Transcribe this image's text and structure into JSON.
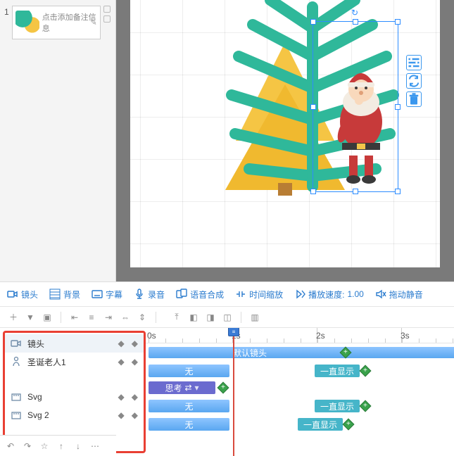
{
  "slide": {
    "number": "1",
    "caption": "点击添加备注信息"
  },
  "object_toolbar": {
    "settings": "settings",
    "replace": "replace",
    "delete": "delete"
  },
  "main_toolbar": {
    "camera": "镜头",
    "background": "背景",
    "subtitle": "字幕",
    "record": "录音",
    "tts": "语音合成",
    "timescale": "时间缩放",
    "speed_label": "播放速度:",
    "speed_value": "1.00",
    "drag_mute": "拖动静音"
  },
  "tracks": [
    {
      "icon": "camera",
      "name": "镜头"
    },
    {
      "icon": "person",
      "name": "圣诞老人1"
    },
    {
      "icon": "svg",
      "name": "Svg"
    },
    {
      "icon": "svg",
      "name": "Svg 2"
    }
  ],
  "ruler": {
    "ticks": [
      "0s",
      "1s",
      "2s",
      "3s"
    ]
  },
  "clips": {
    "camera_default": "默认镜头",
    "none": "无",
    "think": "思考",
    "always_show": "一直显示"
  }
}
